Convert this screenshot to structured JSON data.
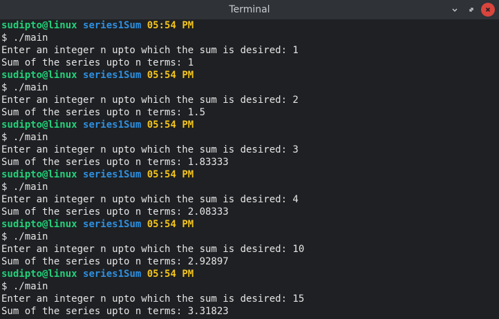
{
  "window": {
    "title": "Terminal"
  },
  "colors": {
    "user": "#23d17a",
    "directory": "#2e8fe0",
    "time": "#f2c31c",
    "text": "#e6e6e6",
    "background": "#1e2023",
    "titlebar": "#2f3237",
    "close_button": "#d9453d"
  },
  "controls": [
    "minimize-icon",
    "maximize-icon",
    "close-icon"
  ],
  "sessions": [
    {
      "user": "sudipto@linux",
      "dir": "series1Sum",
      "time": "05:54 PM",
      "command": "$ ./main",
      "prompt": "Enter an integer n upto which the sum is desired: 1",
      "result": "Sum of the series upto n terms: 1"
    },
    {
      "user": "sudipto@linux",
      "dir": "series1Sum",
      "time": "05:54 PM",
      "command": "$ ./main",
      "prompt": "Enter an integer n upto which the sum is desired: 2",
      "result": "Sum of the series upto n terms: 1.5"
    },
    {
      "user": "sudipto@linux",
      "dir": "series1Sum",
      "time": "05:54 PM",
      "command": "$ ./main",
      "prompt": "Enter an integer n upto which the sum is desired: 3",
      "result": "Sum of the series upto n terms: 1.83333"
    },
    {
      "user": "sudipto@linux",
      "dir": "series1Sum",
      "time": "05:54 PM",
      "command": "$ ./main",
      "prompt": "Enter an integer n upto which the sum is desired: 4",
      "result": "Sum of the series upto n terms: 2.08333"
    },
    {
      "user": "sudipto@linux",
      "dir": "series1Sum",
      "time": "05:54 PM",
      "command": "$ ./main",
      "prompt": "Enter an integer n upto which the sum is desired: 10",
      "result": "Sum of the series upto n terms: 2.92897"
    },
    {
      "user": "sudipto@linux",
      "dir": "series1Sum",
      "time": "05:54 PM",
      "command": "$ ./main",
      "prompt": "Enter an integer n upto which the sum is desired: 15",
      "result": "Sum of the series upto n terms: 3.31823"
    }
  ]
}
